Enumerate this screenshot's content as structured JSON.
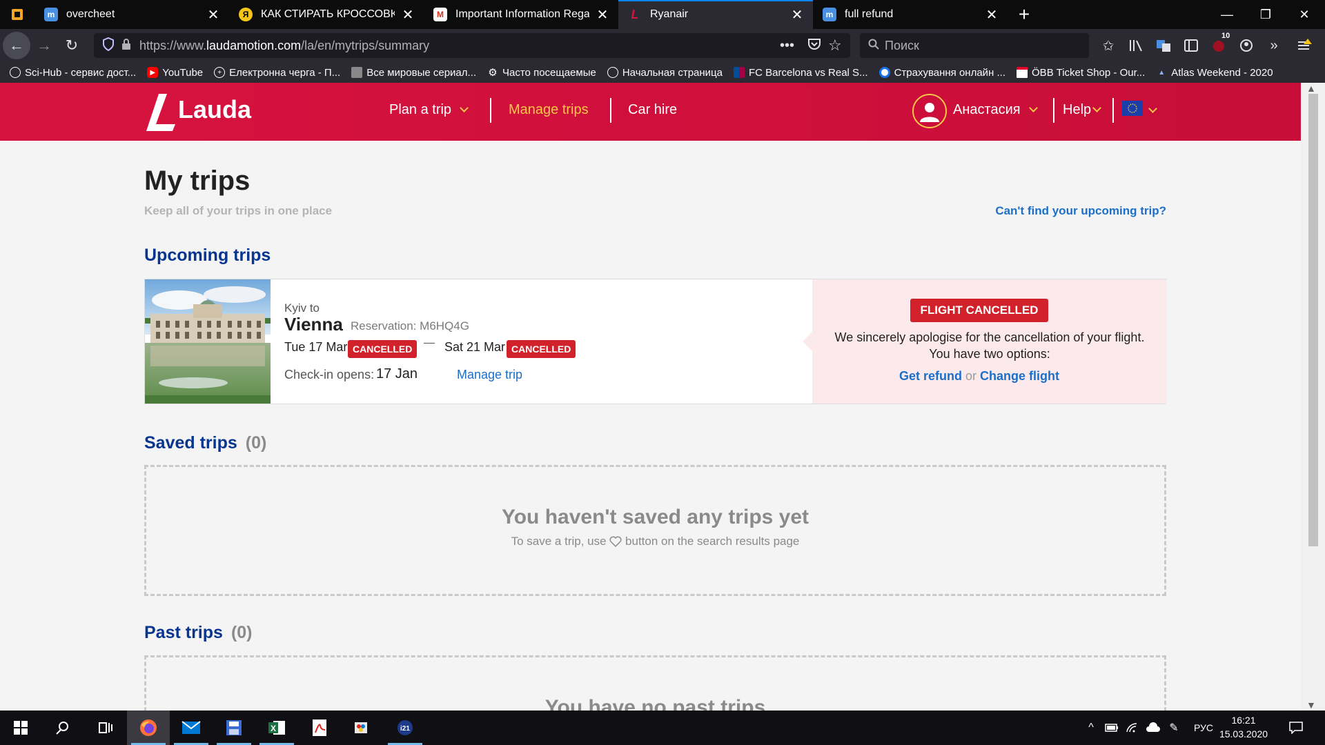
{
  "browser": {
    "tabs": [
      {
        "title": "overcheet",
        "favicon": "m-icon",
        "active": false
      },
      {
        "title": "КАК СТИРАТЬ КРОССОВКИ В С",
        "favicon": "yandex-zen-icon",
        "active": false
      },
      {
        "title": "Important Information Regardi",
        "favicon": "gmail-icon",
        "active": false
      },
      {
        "title": "Ryanair",
        "favicon": "lauda-icon",
        "active": true
      },
      {
        "title": "full refund",
        "favicon": "m-icon",
        "active": false
      }
    ],
    "url_prefix": "https://www.",
    "url_host": "laudamotion.com",
    "url_path": "/la/en/mytrips/summary",
    "search_placeholder": "Поиск",
    "notification_count": "10",
    "bookmarks": [
      {
        "label": "Sci-Hub - сервис дост...",
        "icon": "globe-icon"
      },
      {
        "label": "YouTube",
        "icon": "youtube-icon"
      },
      {
        "label": "Електронна черга - П...",
        "icon": "plus-circle-icon"
      },
      {
        "label": "Все мировые сериал...",
        "icon": "film-icon"
      },
      {
        "label": "Часто посещаемые",
        "icon": "gear-icon"
      },
      {
        "label": "Начальная страница",
        "icon": "globe-icon"
      },
      {
        "label": "FC Barcelona vs Real S...",
        "icon": "flag-icon"
      },
      {
        "label": "Страхування онлайн ...",
        "icon": "shield-icon"
      },
      {
        "label": "ÖBB Ticket Shop - Our...",
        "icon": "obb-icon"
      },
      {
        "label": "Atlas Weekend - 2020",
        "icon": "atlas-icon"
      }
    ]
  },
  "site": {
    "logo_text": "Lauda",
    "nav": {
      "plan_trip": "Plan a trip",
      "manage_trips": "Manage trips",
      "car_hire": "Car hire"
    },
    "user_name": "Анастасия",
    "help": "Help",
    "brand_color": "#d8123f",
    "accent_color": "#f9c847"
  },
  "page": {
    "title": "My trips",
    "subtitle": "Keep all of your trips in one place",
    "cant_find": "Can't find your upcoming trip?",
    "upcoming_title": "Upcoming trips",
    "trip": {
      "from": "Kyiv to",
      "destination": "Vienna",
      "reservation": "Reservation: M6HQ4G",
      "depart_date": "Tue 17 Mar",
      "return_date": "Sat 21 Mar",
      "status_badge": "CANCELLED",
      "checkin_label": "Check-in opens:",
      "checkin_date": "17 Jan",
      "manage_link": "Manage trip"
    },
    "cancel_notice": {
      "badge": "FLIGHT CANCELLED",
      "text": "We sincerely apologise for the cancellation of your flight. You have two options:",
      "refund": "Get refund",
      "or": "or",
      "change": "Change flight"
    },
    "saved_title": "Saved trips",
    "saved_count": "(0)",
    "saved_empty_title": "You haven't saved any trips yet",
    "saved_empty_text_a": "To save a trip, use",
    "saved_empty_text_b": "button on the search results page",
    "past_title": "Past trips",
    "past_count": "(0)",
    "past_empty_title": "You have no past trips"
  },
  "taskbar": {
    "lang": "РУС",
    "time": "16:21",
    "date": "15.03.2020"
  }
}
